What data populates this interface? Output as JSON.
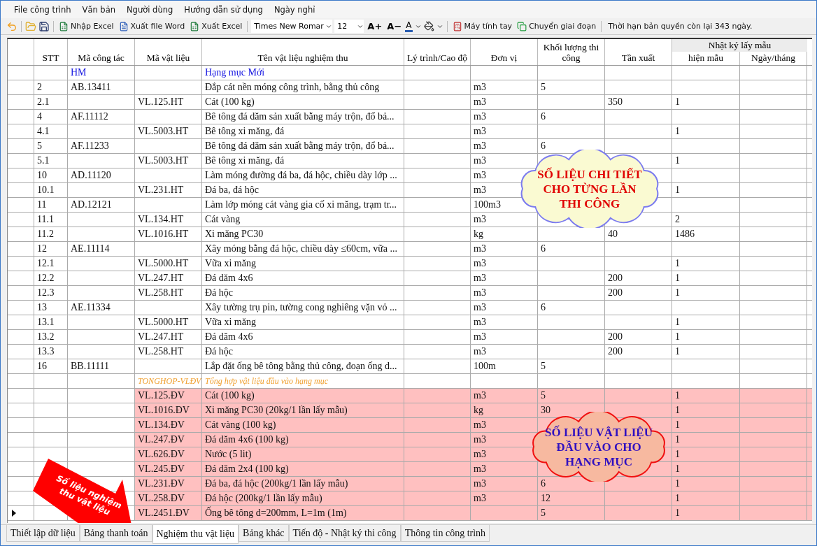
{
  "menu": [
    "File công trình",
    "Văn bản",
    "Người dùng",
    "Hướng dẫn sử dụng",
    "Ngày nghỉ"
  ],
  "toolbar": {
    "import_excel": "Nhập Excel",
    "export_word": "Xuất file Word",
    "export_excel": "Xuất Excel",
    "font_name": "Times New Romar",
    "font_size": "12",
    "grow_font": "A+",
    "shrink_font": "A−",
    "font_color": "A",
    "calculator": "Máy tính tay",
    "change_phase": "Chuyển giai đoạn",
    "license": "Thời hạn bản quyền còn lại 343 ngày."
  },
  "table": {
    "columns": [
      "STT",
      "Mã công tác",
      "Mã vật liệu",
      "Tên vật liệu nghiệm thu",
      "Lý trình/Cao độ",
      "Đơn vị",
      "Khối lượng thi công",
      "Tần xuất"
    ],
    "column_group": {
      "label": "Nhật ký lấy mẫu",
      "columns": [
        "hiện mẫu",
        "Ngày/tháng"
      ]
    },
    "rows": [
      {
        "kind": "category",
        "selected": false,
        "work_code": "HM",
        "name": "Hạng mục Mới"
      },
      {
        "kind": "work",
        "selected": false,
        "stt": "2",
        "work_code": "AB.13411",
        "name": "Đắp cát nền móng công trình, bằng thủ công",
        "unit": "m3",
        "quantity": "5"
      },
      {
        "kind": "material",
        "selected": false,
        "stt": "2.1",
        "material_code": "VL.125.HT",
        "name": "Cát (100 kg)",
        "unit": "m3",
        "frequency": "350",
        "sample_log": "1"
      },
      {
        "kind": "work",
        "selected": false,
        "stt": "4",
        "work_code": "AF.11112",
        "name": "Bê tông đá dăm sản xuất bằng máy trộn, đổ bả...",
        "unit": "m3",
        "quantity": "6"
      },
      {
        "kind": "material",
        "selected": false,
        "stt": "4.1",
        "material_code": "VL.5003.HT",
        "name": "Bê tông xi măng, đá",
        "unit": "m3",
        "sample_log": "1"
      },
      {
        "kind": "work",
        "selected": false,
        "stt": "5",
        "work_code": "AF.11233",
        "name": "Bê tông đá dăm sản xuất bằng máy trộn, đổ bả...",
        "unit": "m3",
        "quantity": "6"
      },
      {
        "kind": "material",
        "selected": false,
        "stt": "5.1",
        "material_code": "VL.5003.HT",
        "name": "Bê tông xi măng, đá",
        "unit": "m3",
        "sample_log": "1"
      },
      {
        "kind": "work",
        "selected": false,
        "stt": "10",
        "work_code": "AD.11120",
        "name": "Làm móng đường đá ba, đá hộc, chiều dày lớp ...",
        "unit": "m3"
      },
      {
        "kind": "material",
        "selected": false,
        "stt": "10.1",
        "material_code": "VL.231.HT",
        "name": "Đá ba, đá hộc",
        "unit": "m3",
        "sample_log": "1"
      },
      {
        "kind": "work",
        "selected": false,
        "stt": "11",
        "work_code": "AD.12121",
        "name": "Làm lớp móng cát vàng gia cố xi măng, trạm tr...",
        "unit": "100m3"
      },
      {
        "kind": "material",
        "selected": false,
        "stt": "11.1",
        "material_code": "VL.134.HT",
        "name": "Cát vàng",
        "unit": "m3",
        "sample_log": "2"
      },
      {
        "kind": "material",
        "selected": false,
        "stt": "11.2",
        "material_code": "VL.1016.HT",
        "name": "Xi măng PC30",
        "unit": "kg",
        "frequency": "40",
        "sample_log": "1486"
      },
      {
        "kind": "work",
        "selected": false,
        "stt": "12",
        "work_code": "AE.11114",
        "name": "Xây móng bằng đá hộc, chiều dày ≤60cm, vữa ...",
        "unit": "m3",
        "quantity": "6"
      },
      {
        "kind": "material",
        "selected": false,
        "stt": "12.1",
        "material_code": "VL.5000.HT",
        "name": "Vữa xi măng",
        "unit": "m3",
        "sample_log": "1"
      },
      {
        "kind": "material",
        "selected": false,
        "stt": "12.2",
        "material_code": "VL.247.HT",
        "name": "Đá dăm 4x6",
        "unit": "m3",
        "frequency": "200",
        "sample_log": "1"
      },
      {
        "kind": "material",
        "selected": false,
        "stt": "12.3",
        "material_code": "VL.258.HT",
        "name": "Đá hộc",
        "unit": "m3",
        "frequency": "200",
        "sample_log": "1"
      },
      {
        "kind": "work",
        "selected": false,
        "stt": "13",
        "work_code": "AE.11334",
        "name": "Xây tường trụ pin, tường cong nghiêng vặn vỏ ...",
        "unit": "m3",
        "quantity": "6"
      },
      {
        "kind": "material",
        "selected": false,
        "stt": "13.1",
        "material_code": "VL.5000.HT",
        "name": "Vữa xi măng",
        "unit": "m3",
        "sample_log": "1"
      },
      {
        "kind": "material",
        "selected": false,
        "stt": "13.2",
        "material_code": "VL.247.HT",
        "name": "Đá dăm 4x6",
        "unit": "m3",
        "frequency": "200",
        "sample_log": "1"
      },
      {
        "kind": "material",
        "selected": false,
        "stt": "13.3",
        "material_code": "VL.258.HT",
        "name": "Đá hộc",
        "unit": "m3",
        "frequency": "200",
        "sample_log": "1"
      },
      {
        "kind": "work",
        "selected": false,
        "stt": "16",
        "work_code": "BB.11111",
        "name": "Lắp đặt ống bê tông bằng thủ công, đoạn ống d...",
        "unit": "100m",
        "quantity": "5"
      },
      {
        "kind": "summary",
        "selected": false,
        "material_code": "TONGHOP-VLĐV",
        "name": "Tổng hợp vật liệu đầu vào hạng mục"
      },
      {
        "kind": "input",
        "selected": false,
        "material_code": "VL.125.ĐV",
        "name": "Cát (100 kg)",
        "unit": "m3",
        "quantity": "5",
        "sample_log": "1"
      },
      {
        "kind": "input",
        "selected": false,
        "material_code": "VL.1016.ĐV",
        "name": "Xi măng PC30 (20kg/1 lần lấy mẫu)",
        "unit": "kg",
        "quantity": "30",
        "sample_log": "1"
      },
      {
        "kind": "input",
        "selected": false,
        "material_code": "VL.134.ĐV",
        "name": "Cát vàng (100 kg)",
        "unit": "m3",
        "sample_log": "1"
      },
      {
        "kind": "input",
        "selected": false,
        "material_code": "VL.247.ĐV",
        "name": "Đá dăm 4x6 (100 kg)",
        "unit": "m3",
        "sample_log": "1"
      },
      {
        "kind": "input",
        "selected": false,
        "material_code": "VL.626.ĐV",
        "name": "Nước (5 lit)",
        "unit": "m3",
        "sample_log": "1"
      },
      {
        "kind": "input",
        "selected": false,
        "material_code": "VL.245.ĐV",
        "name": "Đá dăm 2x4 (100 kg)",
        "unit": "m3",
        "sample_log": "1"
      },
      {
        "kind": "input",
        "selected": false,
        "material_code": "VL.231.ĐV",
        "name": "Đá ba, đá hộc (200kg/1 lần lấy mẫu)",
        "unit": "m3",
        "quantity": "6",
        "sample_log": "1"
      },
      {
        "kind": "input",
        "selected": false,
        "material_code": "VL.258.ĐV",
        "name": "Đá hộc (200kg/1 lần lấy mẫu)",
        "unit": "m3",
        "quantity": "12",
        "sample_log": "1"
      },
      {
        "kind": "input",
        "selected": true,
        "material_code": "VL.2451.ĐV",
        "name": "Ống bê tông d=200mm, L=1m (1m)",
        "quantity": "5",
        "sample_log": "1"
      }
    ]
  },
  "callouts": [
    {
      "kind": "detail",
      "lines": [
        "SỐ LIỆU CHI TIẾT",
        "CHO TỪNG LẦN",
        "THI CÔNG"
      ]
    },
    {
      "kind": "input",
      "lines": [
        "SỐ LIỆU VẬT LIỆU",
        "ĐẦU VÀO CHO",
        "HẠNG MỤC"
      ]
    }
  ],
  "arrow_label": "Số liệu nghiệm thu vật liệu",
  "tabs": [
    {
      "label": "Thiết lập dữ liệu",
      "selected": false
    },
    {
      "label": "Bảng thanh toán",
      "selected": false
    },
    {
      "label": "Nghiệm thu vật liệu",
      "selected": true
    },
    {
      "label": "Bảng khác",
      "selected": false
    },
    {
      "label": "Tiến độ - Nhật ký thi công",
      "selected": false
    },
    {
      "label": "Thông tin công trình",
      "selected": false
    }
  ]
}
